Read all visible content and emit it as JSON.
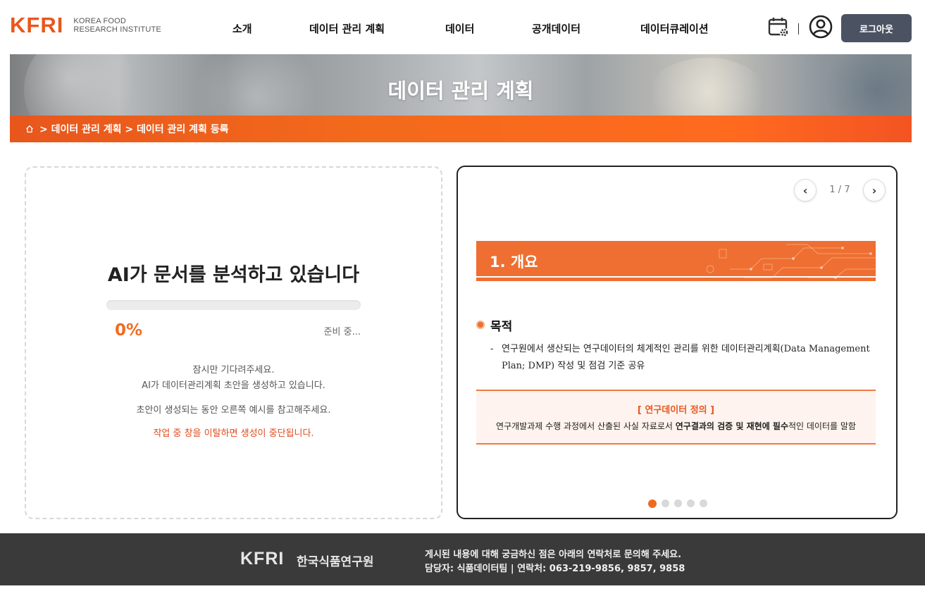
{
  "header": {
    "logo_mark": "KFRI",
    "logo_text_line1": "KOREA FOOD",
    "logo_text_line2": "RESEARCH INSTITUTE",
    "nav": [
      "소개",
      "데이터 관리 계획",
      "데이터",
      "공개데이터",
      "데이터큐레이션"
    ],
    "separator": "|",
    "logout_label": "로그아웃",
    "icons": [
      "calendar-settings-icon",
      "user-circle-icon"
    ]
  },
  "banner": {
    "title": "데이터 관리 계획"
  },
  "breadcrumb": {
    "text": "> 데이터 관리 계획 > 데이터 관리 계획 등록"
  },
  "progress_panel": {
    "title": "AI가 문서를 분석하고 있습니다",
    "percent_label": "0%",
    "progress": 0,
    "status": "준비 중...",
    "message1": "잠시만 기다려주세요.",
    "message2": "AI가 데이터관리계획 초안을 생성하고 있습니다.",
    "message3": "초안이 생성되는 동안 오른쪽 예시를 참고해주세요.",
    "warning": "작업 중 창을 이탈하면 생성이 중단됩니다."
  },
  "example_panel": {
    "prev_label": "‹",
    "next_label": "›",
    "page_indicator": "1 / 7",
    "section_title": "1. 개요",
    "bullet_title": "목적",
    "dash": "-",
    "description": "연구원에서 생산되는 연구데이터의 체계적인 관리를 위한 데이터관리계획(Data Management Plan; DMP) 작성 및 점검 기준 공유",
    "definition_title": "[ 연구데이터 정의 ]",
    "definition_pre": "연구개발과제 수행 과정에서 산출된 사실 자료로서 ",
    "definition_bold": "연구결과의 검증 및 재현에 필수",
    "definition_post": "적인 데이터를 말함",
    "dots_count": 5,
    "active_dot": 0
  },
  "footer": {
    "logo_mark": "KFRI",
    "org_name": "한국식품연구원",
    "line1": "게시된 내용에 대해 궁금하신 점은 아래의 연락처로 문의해 주세요.",
    "line2": "담당자: 식품데이터팀 | 연락처: 063-219-9856, 9857, 9858"
  },
  "colors": {
    "accent": "#f26a21",
    "logout_bg": "#4b5363",
    "footer_bg": "#3a3a3a"
  }
}
